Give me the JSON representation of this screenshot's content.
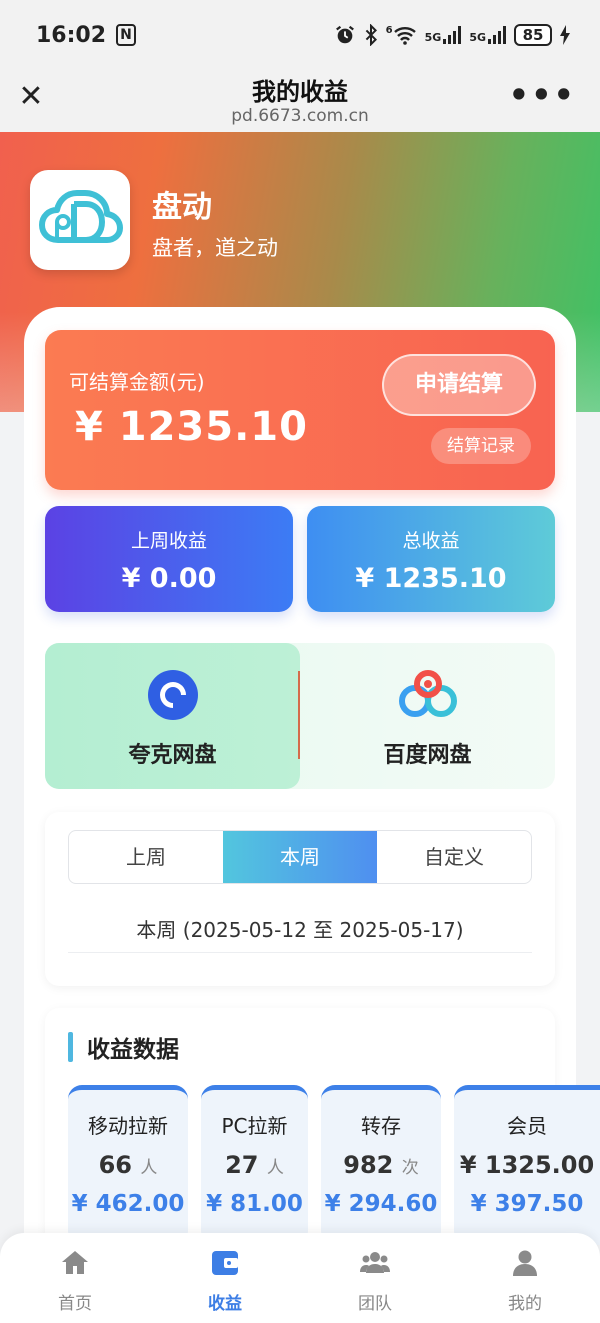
{
  "status_bar": {
    "time": "16:02",
    "battery": "85",
    "nfc": "N",
    "net1": "5G",
    "net2": "5G",
    "wifi_sub": "6"
  },
  "navbar": {
    "title": "我的收益",
    "url": "pd.6673.com.cn"
  },
  "brand": {
    "name": "盘动",
    "slogan": "盘者，道之动"
  },
  "settle": {
    "label": "可结算金额(元)",
    "amount": "¥ 1235.10",
    "apply_label": "申请结算",
    "record_label": "结算记录"
  },
  "stats": {
    "last_week_label": "上周收益",
    "last_week_value": "¥ 0.00",
    "total_label": "总收益",
    "total_value": "¥ 1235.10"
  },
  "disks": [
    {
      "name": "夸克网盘",
      "icon": "quark-icon",
      "selected": true
    },
    {
      "name": "百度网盘",
      "icon": "baidu-netdisk-icon",
      "selected": false
    }
  ],
  "period": {
    "tabs": [
      {
        "label": "上周"
      },
      {
        "label": "本周"
      },
      {
        "label": "自定义"
      }
    ],
    "active_tab": "本周",
    "range": "本周 (2025-05-12 至 2025-05-17)"
  },
  "data_section": {
    "title": "收益数据",
    "cards": [
      {
        "name": "移动拉新",
        "count": "66",
        "unit": "人",
        "money": "¥ 462.00"
      },
      {
        "name": "PC拉新",
        "count": "27",
        "unit": "人",
        "money": "¥ 81.00"
      },
      {
        "name": "转存",
        "count": "982",
        "unit": "次",
        "money": "¥ 294.60"
      },
      {
        "name": "会员",
        "count": "¥ 1325.00",
        "unit": "",
        "money": "¥ 397.50"
      }
    ]
  },
  "tabbar": {
    "items": [
      {
        "label": "首页",
        "icon": "home-icon"
      },
      {
        "label": "收益",
        "icon": "wallet-icon"
      },
      {
        "label": "团队",
        "icon": "team-icon"
      },
      {
        "label": "我的",
        "icon": "user-icon"
      }
    ],
    "active": "收益"
  },
  "colors": {
    "accent": "#3d7ee5",
    "settle": "#f86351",
    "hero_left": "#f1604e",
    "hero_right": "#3ec265"
  }
}
